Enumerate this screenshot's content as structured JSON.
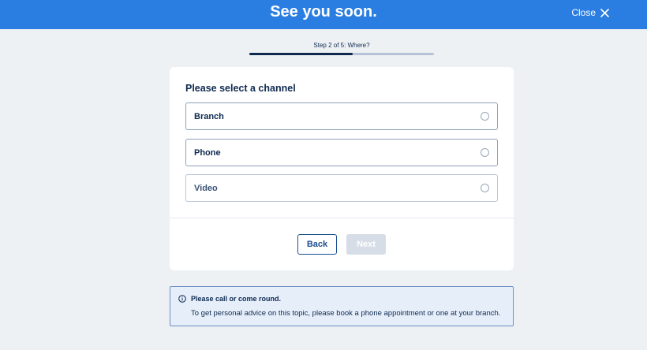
{
  "header": {
    "title": "See you soon.",
    "close_label": "Close",
    "background_color": "#2a7de1"
  },
  "stepper": {
    "label": "Step 2 of 5: Where?",
    "current_step": 2,
    "total_steps": 5,
    "progress_fraction": 0.56
  },
  "form": {
    "heading": "Please select a channel",
    "options": [
      {
        "label": "Branch",
        "selected": false
      },
      {
        "label": "Phone",
        "selected": false
      },
      {
        "label": "Video",
        "selected": false
      }
    ],
    "back_label": "Back",
    "next_label": "Next",
    "next_enabled": false
  },
  "notice": {
    "icon": "info-icon",
    "title": "Please call or come round.",
    "text": "To get personal advice on this topic, please book a phone appointment or one at your branch."
  }
}
